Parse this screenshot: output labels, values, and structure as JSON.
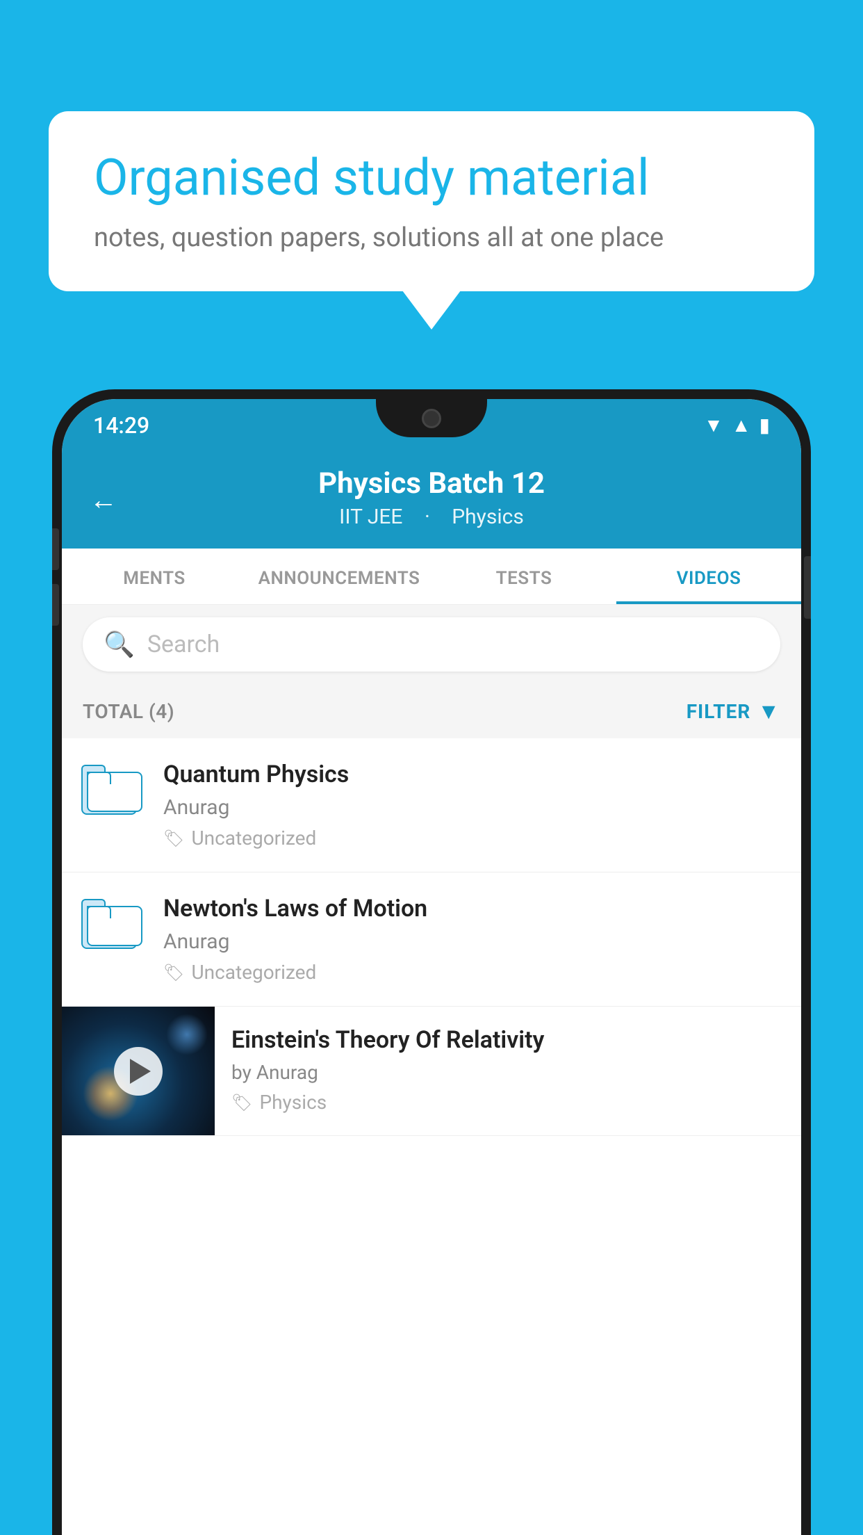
{
  "bubble": {
    "title": "Organised study material",
    "subtitle": "notes, question papers, solutions all at one place"
  },
  "status_bar": {
    "time": "14:29",
    "icons": [
      "wifi",
      "signal",
      "battery"
    ]
  },
  "header": {
    "title": "Physics Batch 12",
    "subtitle_part1": "IIT JEE",
    "subtitle_part2": "Physics",
    "back_label": "←"
  },
  "tabs": [
    {
      "label": "MENTS",
      "active": false
    },
    {
      "label": "ANNOUNCEMENTS",
      "active": false
    },
    {
      "label": "TESTS",
      "active": false
    },
    {
      "label": "VIDEOS",
      "active": true
    }
  ],
  "search": {
    "placeholder": "Search"
  },
  "filter_bar": {
    "total_label": "TOTAL (4)",
    "filter_label": "FILTER"
  },
  "videos": [
    {
      "title": "Quantum Physics",
      "author": "Anurag",
      "tag": "Uncategorized",
      "has_thumbnail": false
    },
    {
      "title": "Newton's Laws of Motion",
      "author": "Anurag",
      "tag": "Uncategorized",
      "has_thumbnail": false
    },
    {
      "title": "Einstein's Theory Of Relativity",
      "author": "by Anurag",
      "tag": "Physics",
      "has_thumbnail": true
    }
  ]
}
